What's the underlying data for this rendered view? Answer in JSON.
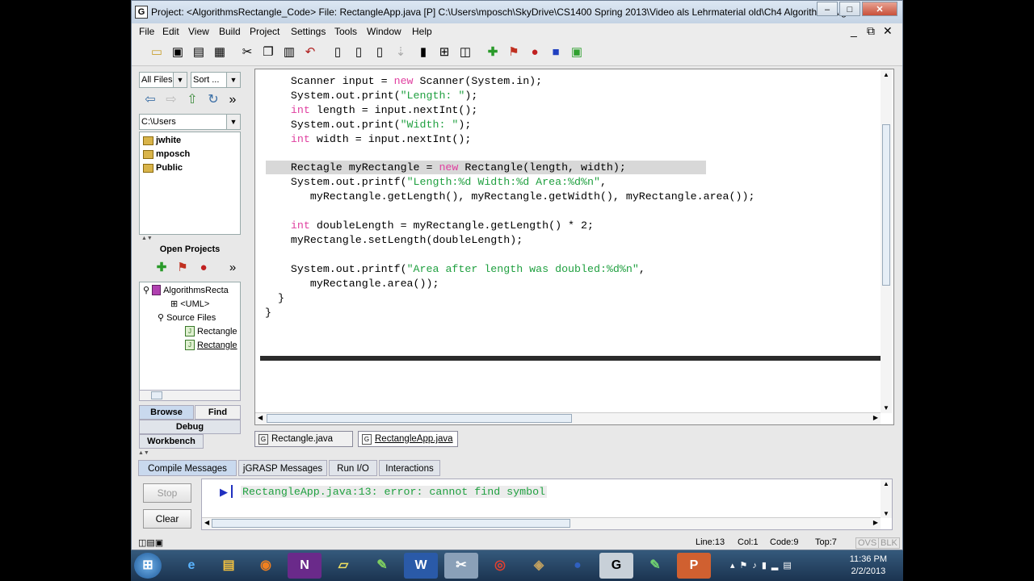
{
  "window": {
    "title": "Project: <AlgorithmsRectangle_Code>   File: RectangleApp.java [P]  C:\\Users\\mposch\\SkyDrive\\CS1400 Spring 2013\\Video als Lehrmaterial old\\Ch4 Algorithms\\Alg...",
    "app_icon": "G",
    "minimize": "–",
    "maximize": "□",
    "close": "✕",
    "mdi_minimize": "_",
    "mdi_restore": "⧉",
    "mdi_close": "✕"
  },
  "menu": [
    "File",
    "Edit",
    "View",
    "Build",
    "Project",
    "Settings",
    "Tools",
    "Window",
    "Help"
  ],
  "browser": {
    "filter": "All Files",
    "sort": "Sort ...",
    "path": "C:\\Users",
    "folders": [
      "jwhite",
      "mposch",
      "Public"
    ],
    "open_projects_label": "Open Projects",
    "more": "»",
    "project_root": "AlgorithmsRecta",
    "uml": "<UML>",
    "source_files": "Source Files",
    "files": [
      "Rectangle",
      "Rectangle"
    ],
    "tabs": {
      "browse": "Browse",
      "find": "Find",
      "debug": "Debug",
      "workbench": "Workbench"
    }
  },
  "editor": {
    "lines": [
      "    Scanner input = new Scanner(System.in);",
      "    System.out.print(\"Length: \");",
      "    int length = input.nextInt();",
      "    System.out.print(\"Width: \");",
      "    int width = input.nextInt();",
      "",
      "    Rectagle myRectangle = new Rectangle(length, width);",
      "    System.out.printf(\"Length:%d Width:%d Area:%d%n\",",
      "       myRectangle.getLength(), myRectangle.getWidth(), myRectangle.area());",
      "",
      "    int doubleLength = myRectangle.getLength() * 2;",
      "    myRectangle.setLength(doubleLength);",
      "",
      "    System.out.printf(\"Area after length was doubled:%d%n\",",
      "       myRectangle.area());",
      "  }",
      "}"
    ],
    "tabs": [
      "Rectangle.java",
      "RectangleApp.java"
    ]
  },
  "messages": {
    "tabs": [
      "Compile Messages",
      "jGRASP Messages",
      "Run I/O",
      "Interactions"
    ],
    "stop": "Stop",
    "clear": "Clear",
    "text": "RectangleApp.java:13: error: cannot find symbol"
  },
  "status": {
    "line": "Line:13",
    "col": "Col:1",
    "code": "Code:9",
    "top": "Top:7",
    "ovs": "OVS",
    "blk": "BLK"
  },
  "taskbar": {
    "time": "11:36 PM",
    "date": "2/2/2013"
  },
  "colors": {
    "keyword": "#e040a0",
    "string": "#20a040",
    "error_text": "#20a040"
  }
}
